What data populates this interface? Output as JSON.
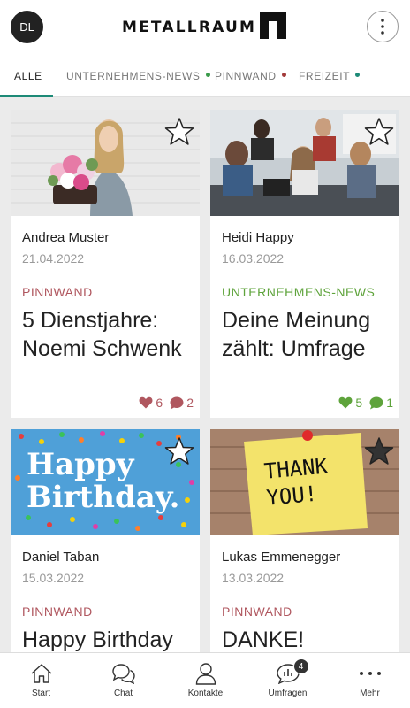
{
  "header": {
    "avatar_initials": "DL",
    "brand": "METALLRAUM"
  },
  "tabs": [
    {
      "label": "ALLE",
      "dot_color": null
    },
    {
      "label": "UNTERNEHMENS-NEWS",
      "dot_color": "#3a9a4a"
    },
    {
      "label": "PINNWAND",
      "dot_color": "#a23a3a"
    },
    {
      "label": "FREIZEIT",
      "dot_color": "#1d8a77"
    }
  ],
  "colors": {
    "accent": "#1d8a77",
    "pinnwand": "#b0575f",
    "news": "#5ea33b",
    "heart_red": "#b0575f",
    "heart_green": "#5ea33b"
  },
  "cards": [
    {
      "image": "woman-with-flowers",
      "starred": false,
      "author": "Andrea Muster",
      "date": "21.04.2022",
      "category": "PINNWAND",
      "title": "5 Dienstjahre: Noemi Schwenk",
      "likes": "6",
      "comments": "2"
    },
    {
      "image": "office-meeting",
      "starred": false,
      "author": "Heidi Happy",
      "date": "16.03.2022",
      "category": "UNTERNEHMENS-NEWS",
      "title": "Deine Meinung zählt: Umfrage",
      "likes": "5",
      "comments": "1"
    },
    {
      "image": "happy-birthday-confetti",
      "image_text": "Happy Birthday.",
      "starred": false,
      "author": "Daniel Taban",
      "date": "15.03.2022",
      "category": "PINNWAND",
      "title": "Happy Birthday"
    },
    {
      "image": "thank-you-note",
      "image_text": "THANK YOU!",
      "starred": true,
      "author": "Lukas Emmenegger",
      "date": "13.03.2022",
      "category": "PINNWAND",
      "title": "DANKE!"
    }
  ],
  "bottom_nav": [
    {
      "label": "Start",
      "icon": "home-icon"
    },
    {
      "label": "Chat",
      "icon": "chat-icon"
    },
    {
      "label": "Kontakte",
      "icon": "person-icon"
    },
    {
      "label": "Umfragen",
      "icon": "poll-icon",
      "badge": "4"
    },
    {
      "label": "Mehr",
      "icon": "more-dots-icon"
    }
  ]
}
